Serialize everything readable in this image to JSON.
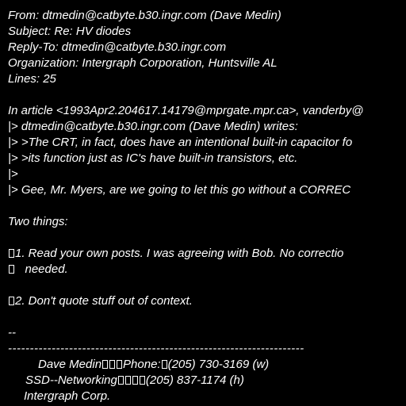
{
  "header": {
    "from": "From: dtmedin@catbyte.b30.ingr.com (Dave Medin)",
    "subject": "Subject: Re: HV diodes",
    "reply_to": "Reply-To: dtmedin@catbyte.b30.ingr.com",
    "organization": "Organization: Intergraph Corporation, Huntsville AL",
    "lines": "Lines: 25"
  },
  "body": {
    "attribution": "In article <1993Apr2.204617.14179@mprgate.mpr.ca>, vanderby@",
    "quote1": "|> dtmedin@catbyte.b30.ingr.com (Dave Medin) writes:",
    "quote2": "|> >The CRT, in fact, does have an intentional built-in capacitor fo",
    "quote3": "|> >its function just as IC's have built-in transistors, etc.",
    "quote4": "|>",
    "quote5": "|> Gee, Mr. Myers, are we going to let this go without a CORREC",
    "two_things": "Two things:",
    "point1a": "1. Read your own posts. I was agreeing with Bob. No correctio",
    "point1b": "   needed.",
    "point2": "2. Don't quote stuff out of context."
  },
  "signature": {
    "dashes": "--",
    "rule": "--------------------------------------------------------------------",
    "name": "Dave Medin",
    "phone_label": "Phone:",
    "phone": "(205) 730-3169 (w)",
    "dept": "SSD--Networking",
    "phone2": "(205) 837-1174 (h)",
    "company": "Intergraph Corp."
  }
}
